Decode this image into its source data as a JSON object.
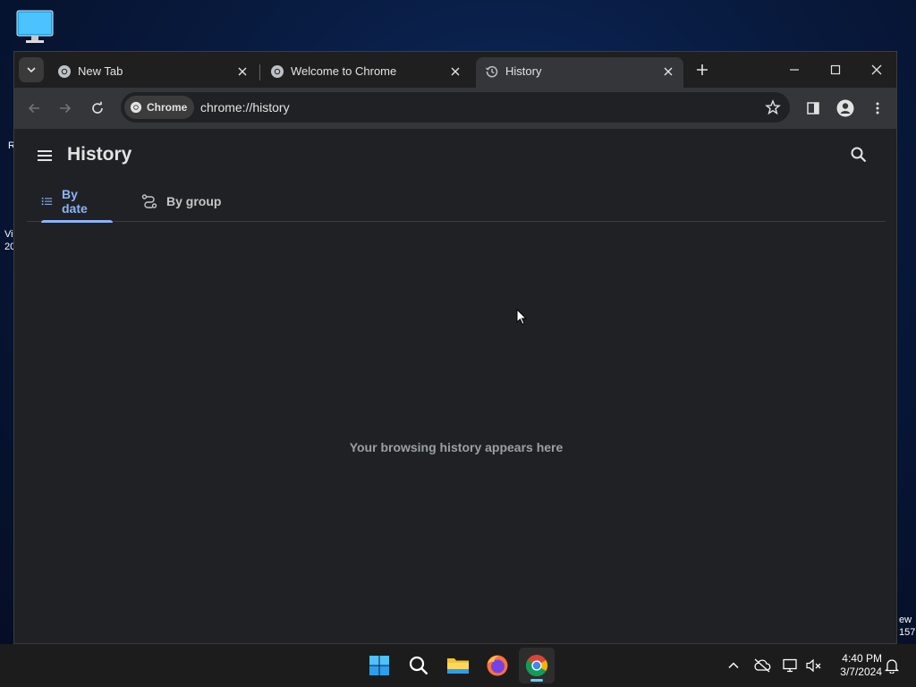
{
  "desktop": {
    "edge_texts": [
      "R",
      "Vi",
      "20",
      "ew",
      "157"
    ]
  },
  "browser": {
    "tabs": [
      {
        "title": "New Tab",
        "icon": "chrome-icon",
        "active": false
      },
      {
        "title": "Welcome to Chrome",
        "icon": "chrome-icon",
        "active": false
      },
      {
        "title": "History",
        "icon": "history-icon",
        "active": true
      }
    ],
    "omnibox": {
      "chip_label": "Chrome",
      "url": "chrome://history"
    }
  },
  "history_page": {
    "title": "History",
    "tabs": [
      {
        "label": "By date",
        "icon": "list-icon",
        "selected": true
      },
      {
        "label": "By group",
        "icon": "group-icon",
        "selected": false
      }
    ],
    "empty_message": "Your browsing history appears here"
  },
  "taskbar": {
    "apps": [
      "windows-start-icon",
      "search-icon",
      "file-explorer-icon",
      "firefox-icon",
      "chrome-icon"
    ],
    "active_app": "chrome-icon",
    "time": "4:40 PM",
    "date": "3/7/2024"
  },
  "colors": {
    "accent": "#8ab4f8",
    "taskbar_indicator": "#60cdff",
    "page_background": "#202124",
    "toolbar": "#35363a"
  }
}
